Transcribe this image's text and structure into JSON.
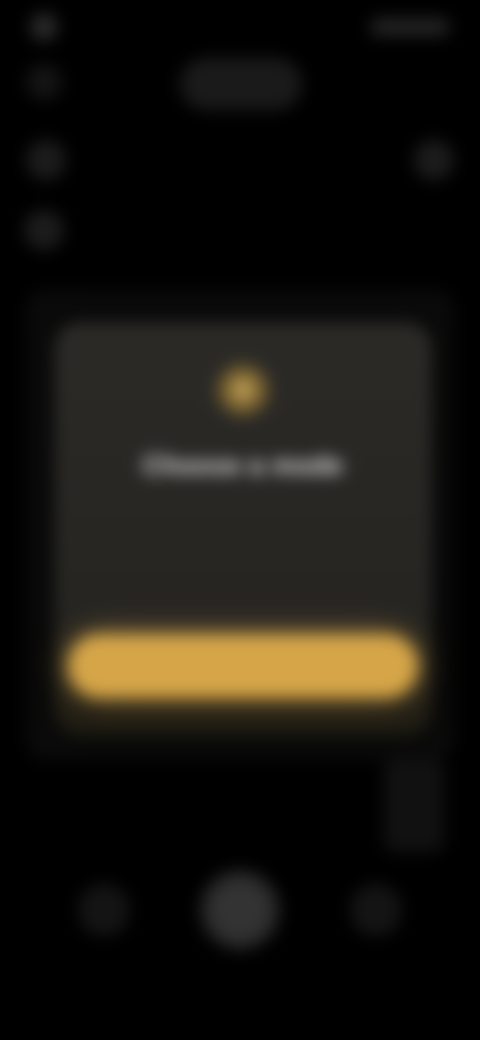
{
  "status_bar": {
    "time": "",
    "indicators": ""
  },
  "top_bar": {
    "mode_label": ""
  },
  "icons": {
    "back": "back-icon",
    "flash": "flash-icon",
    "grid": "grid-icon",
    "settings": "gear-icon",
    "dialog": "lock-icon",
    "gallery": "image-icon",
    "shutter": "shutter-icon",
    "flip": "flip-camera-icon"
  },
  "dialog": {
    "title": "Choose a mode",
    "subtitle": "",
    "hint": "",
    "button_label": ""
  },
  "colors": {
    "accent": "#d5a548",
    "dialog_bg": "#2b2a27",
    "background": "#000000"
  }
}
